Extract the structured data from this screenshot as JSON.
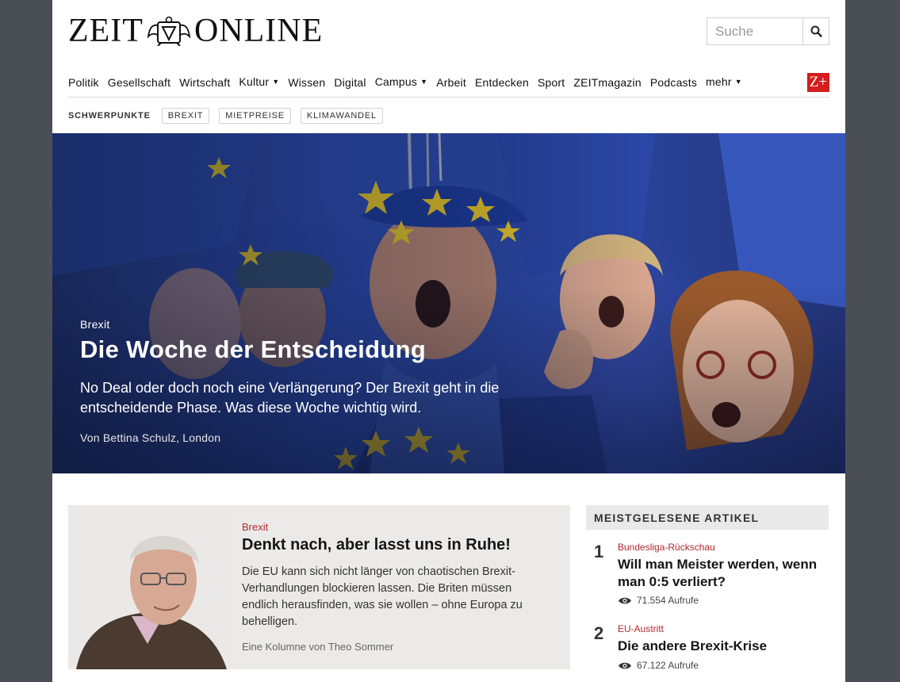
{
  "header": {
    "logo_left": "ZEIT",
    "logo_right": "ONLINE",
    "search_placeholder": "Suche"
  },
  "nav": {
    "items": [
      {
        "label": "Politik"
      },
      {
        "label": "Gesellschaft"
      },
      {
        "label": "Wirtschaft"
      },
      {
        "label": "Kultur",
        "dropdown": true
      },
      {
        "label": "Wissen"
      },
      {
        "label": "Digital"
      },
      {
        "label": "Campus",
        "dropdown": true
      },
      {
        "label": "Arbeit"
      },
      {
        "label": "Entdecken"
      },
      {
        "label": "Sport"
      },
      {
        "label": "ZEITmagazin"
      },
      {
        "label": "Podcasts"
      },
      {
        "label": "mehr",
        "dropdown": true
      }
    ],
    "zplus_label": "Z+",
    "caret": "▼"
  },
  "schwerpunkte": {
    "label": "SCHWERPUNKTE",
    "tags": [
      "BREXIT",
      "MIETPREISE",
      "KLIMAWANDEL"
    ]
  },
  "hero": {
    "kicker": "Brexit",
    "title": "Die Woche der Entscheidung",
    "teaser": "No Deal oder doch noch eine Verlängerung? Der Brexit geht in die entscheidende Phase. Was diese Woche wichtig wird.",
    "byline": "Von Bettina Schulz, London"
  },
  "column": {
    "kicker": "Brexit",
    "title": "Denkt nach, aber lasst uns in Ruhe!",
    "teaser": "Die EU kann sich nicht länger von chaotischen Brexit-Verhandlungen blockieren lassen. Die Briten müssen endlich herausfinden, was sie wollen – ohne Europa zu behelligen.",
    "byline": "Eine Kolumne von Theo Sommer"
  },
  "meistgelesen": {
    "heading": "MEISTGELESENE ARTIKEL",
    "items": [
      {
        "rank": "1",
        "kicker": "Bundesliga-Rückschau",
        "title": "Will man Meister werden, wenn man 0:5 verliert?",
        "views": "71.554 Aufrufe"
      },
      {
        "rank": "2",
        "kicker": "EU-Austritt",
        "title": "Die andere Brexit-Krise",
        "views": "67.122 Aufrufe"
      }
    ]
  },
  "colors": {
    "page_background": "#4a4f55",
    "accent_red": "#b3282d",
    "zplus_red": "#d61c1c",
    "eu_blue": "#2c4aa8",
    "eu_star": "#f2cf22"
  }
}
